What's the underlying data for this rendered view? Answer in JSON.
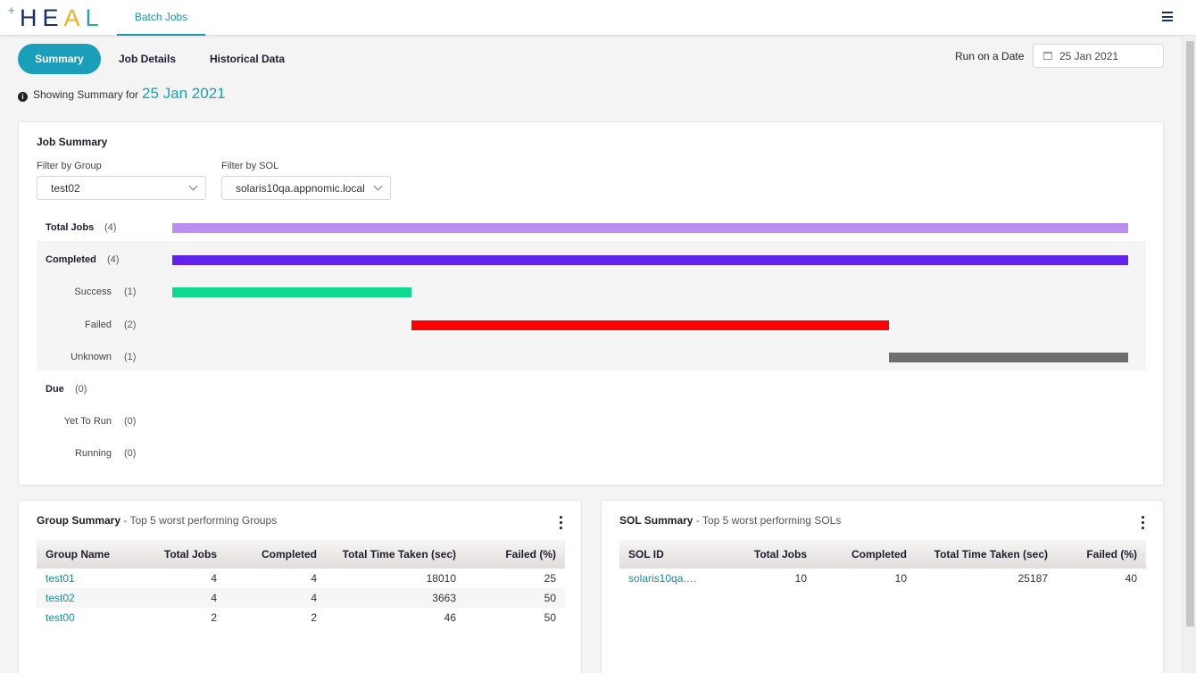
{
  "header": {
    "logo_text": "HEAL",
    "active_tab": "Batch Jobs"
  },
  "subtabs": [
    "Summary",
    "Job Details",
    "Historical Data"
  ],
  "run_on_date": {
    "label": "Run on a Date",
    "value": "25 Jan 2021"
  },
  "showing": {
    "text": "Showing Summary for",
    "date": "25 Jan 2021"
  },
  "job_summary": {
    "title": "Job Summary",
    "filter_group": {
      "label": "Filter by Group",
      "value": "test02"
    },
    "filter_sol": {
      "label": "Filter by SOL",
      "value": "solaris10qa.appnomic.local"
    },
    "total": 4,
    "rows": [
      {
        "label": "Total Jobs",
        "count": "(4)",
        "main": true,
        "start": 0,
        "span": 4,
        "color": "#bb8ef2"
      },
      {
        "label": "Completed",
        "count": "(4)",
        "main": true,
        "start": 0,
        "span": 4,
        "color": "#6222ee"
      },
      {
        "label": "Success",
        "count": "(1)",
        "main": false,
        "start": 0,
        "span": 1,
        "color": "#0fd98f"
      },
      {
        "label": "Failed",
        "count": "(2)",
        "main": false,
        "start": 1,
        "span": 2,
        "color": "#fd0000"
      },
      {
        "label": "Unknown",
        "count": "(1)",
        "main": false,
        "start": 3,
        "span": 1,
        "color": "#6e6e6e"
      },
      {
        "label": "Due",
        "count": "(0)",
        "main": true,
        "start": 0,
        "span": 0,
        "color": "#999999"
      },
      {
        "label": "Yet To Run",
        "count": "(0)",
        "main": false,
        "start": 0,
        "span": 0,
        "color": "#999999"
      },
      {
        "label": "Running",
        "count": "(0)",
        "main": false,
        "start": 0,
        "span": 0,
        "color": "#999999"
      }
    ]
  },
  "group_summary": {
    "title": "Group Summary",
    "subtitle": " - Top 5 worst performing Groups",
    "columns": [
      "Group Name",
      "Total Jobs",
      "Completed",
      "Total Time Taken (sec)",
      "Failed (%)"
    ],
    "rows": [
      [
        "test01",
        "4",
        "4",
        "18010",
        "25"
      ],
      [
        "test02",
        "4",
        "4",
        "3663",
        "50"
      ],
      [
        "test00",
        "2",
        "2",
        "46",
        "50"
      ]
    ]
  },
  "sol_summary": {
    "title": "SOL Summary",
    "subtitle": " - Top 5 worst performing SOLs",
    "columns": [
      "SOL ID",
      "Total Jobs",
      "Completed",
      "Total Time Taken (sec)",
      "Failed (%)"
    ],
    "rows": [
      [
        "solaris10qa.…",
        "10",
        "10",
        "25187",
        "40"
      ]
    ]
  }
}
